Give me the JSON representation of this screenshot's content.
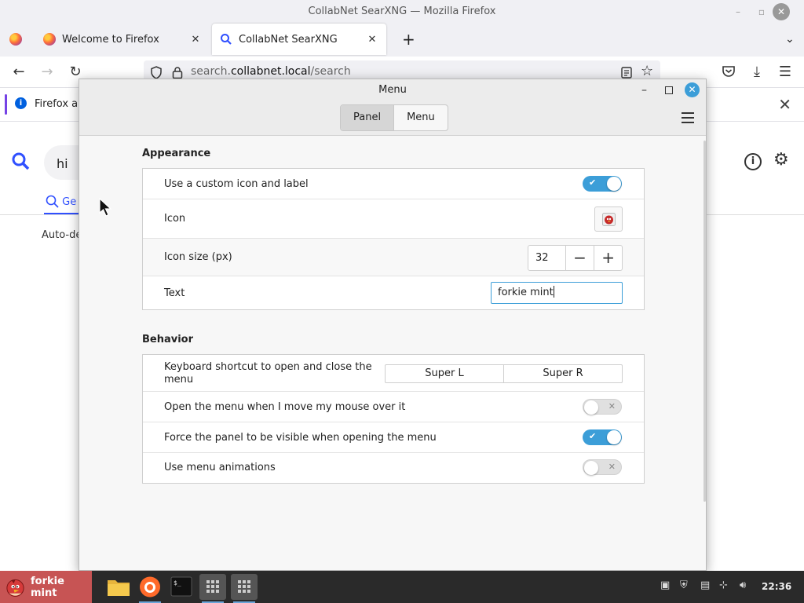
{
  "window_title": "CollabNet SearXNG — Mozilla Firefox",
  "tabs": [
    {
      "title": "Welcome to Firefox"
    },
    {
      "title": "CollabNet SearXNG"
    }
  ],
  "address": {
    "prefix": "search.",
    "host": "collabnet.local",
    "path": "/search"
  },
  "notification": {
    "text": "Firefox au"
  },
  "page": {
    "query": "hi",
    "category_tab": "Ge",
    "autodetect": "Auto-de"
  },
  "dialog": {
    "title": "Menu",
    "switcher": [
      "Panel",
      "Menu"
    ],
    "active_switch": "Panel",
    "appearance": {
      "heading": "Appearance",
      "custom_icon_label": "Use a custom icon and label",
      "custom_icon_enabled": true,
      "icon_label": "Icon",
      "icon_name": "angry-bird-icon",
      "icon_size_label": "Icon size (px)",
      "icon_size_value": "32",
      "text_label": "Text",
      "text_value": "forkie mint"
    },
    "behavior": {
      "heading": "Behavior",
      "shortcut_label": "Keyboard shortcut to open and close the menu",
      "shortcut_keys": [
        "Super L",
        "Super R"
      ],
      "hover_label": "Open the menu when I move my mouse over it",
      "hover_enabled": false,
      "force_panel_label": "Force the panel to be visible when opening the menu",
      "force_panel_enabled": true,
      "animations_label": "Use menu animations",
      "animations_enabled": false
    }
  },
  "taskbar": {
    "menu_label": "forkie mint",
    "apps": [
      "folder-icon",
      "firefox-icon",
      "terminal-icon",
      "app-grid-icon",
      "app-grid-icon"
    ],
    "clock": "22:36"
  },
  "colors": {
    "accent": "#3c9ed8",
    "taskbar_menu": "#c75454",
    "searxng_blue": "#3050ff"
  }
}
